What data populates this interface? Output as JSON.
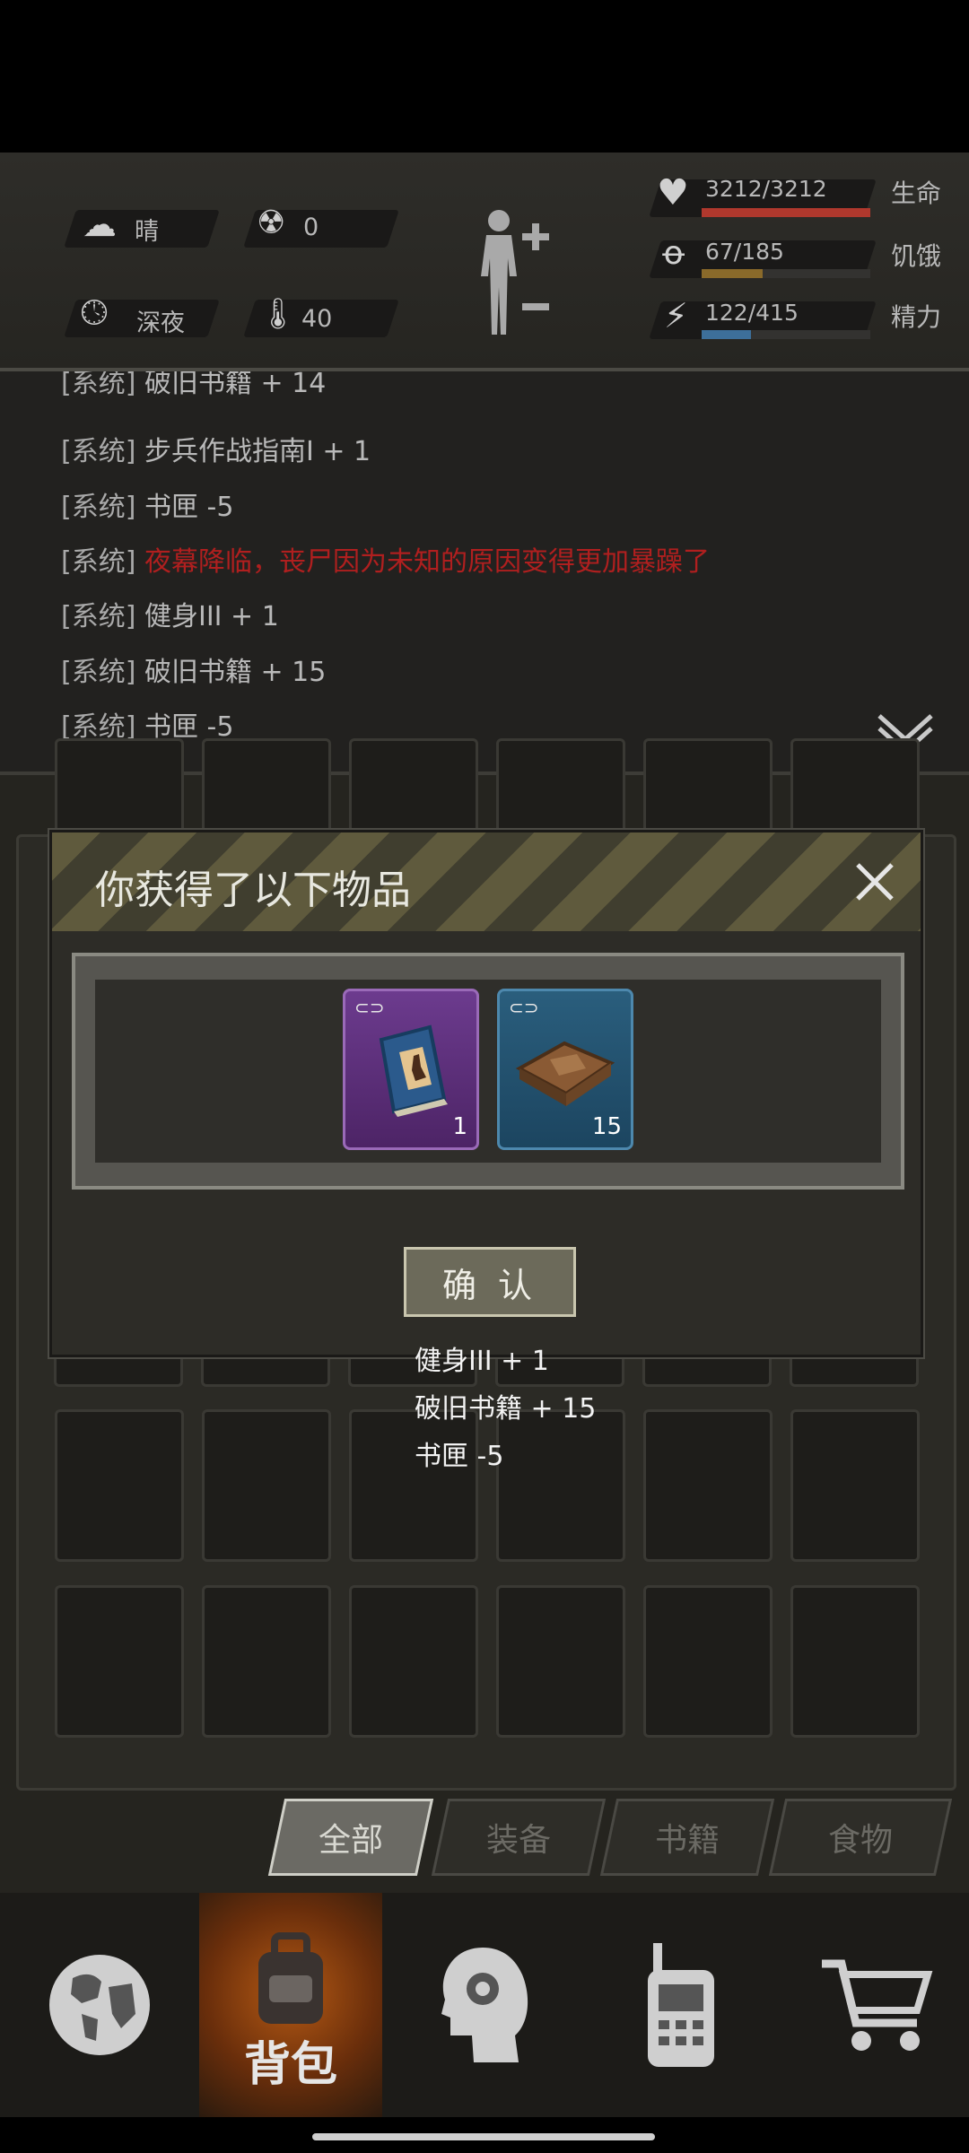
{
  "stats": {
    "weather": "晴",
    "radiation": "0",
    "time_of_day": "深夜",
    "temperature": "40",
    "health": {
      "value": "3212/3212",
      "label": "生命",
      "fill": 1.0,
      "color": "#b0382d"
    },
    "hunger": {
      "value": "67/185",
      "label": "饥饿",
      "fill": 0.36,
      "color": "#8a6a2a"
    },
    "energy": {
      "value": "122/415",
      "label": "精力",
      "fill": 0.29,
      "color": "#3d6f9a"
    }
  },
  "log": {
    "lines": [
      {
        "tag": "[系统]",
        "msg": "破旧书籍 + 14"
      },
      {
        "tag": "[系统]",
        "msg": "步兵作战指南Ⅰ + 1"
      },
      {
        "tag": "[系统]",
        "msg": "书匣 -5"
      },
      {
        "tag": "[系统]",
        "msg": "夜幕降临，丧尸因为未知的原因变得更加暴躁了"
      },
      {
        "tag": "[系统]",
        "msg": "健身III + 1"
      },
      {
        "tag": "[系统]",
        "msg": "破旧书籍 + 15"
      },
      {
        "tag": "[系统]",
        "msg": "书匣 -5"
      }
    ]
  },
  "dialog": {
    "title": "你获得了以下物品",
    "items": [
      {
        "name": "skill-book",
        "qty": "1",
        "color": "#6a3a8a"
      },
      {
        "name": "old-books",
        "qty": "15",
        "color": "#2a5a78"
      }
    ],
    "confirm_label": "确 认"
  },
  "float_messages": [
    "健身III + 1",
    "破旧书籍 + 15",
    "书匣 -5"
  ],
  "tabs": [
    "全部",
    "装备",
    "书籍",
    "食物"
  ],
  "active_tab": "全部",
  "nav": {
    "backpack_label": "背包",
    "items": [
      "globe-icon",
      "backpack-icon",
      "head-gear-icon",
      "radio-icon",
      "cart-icon"
    ]
  }
}
